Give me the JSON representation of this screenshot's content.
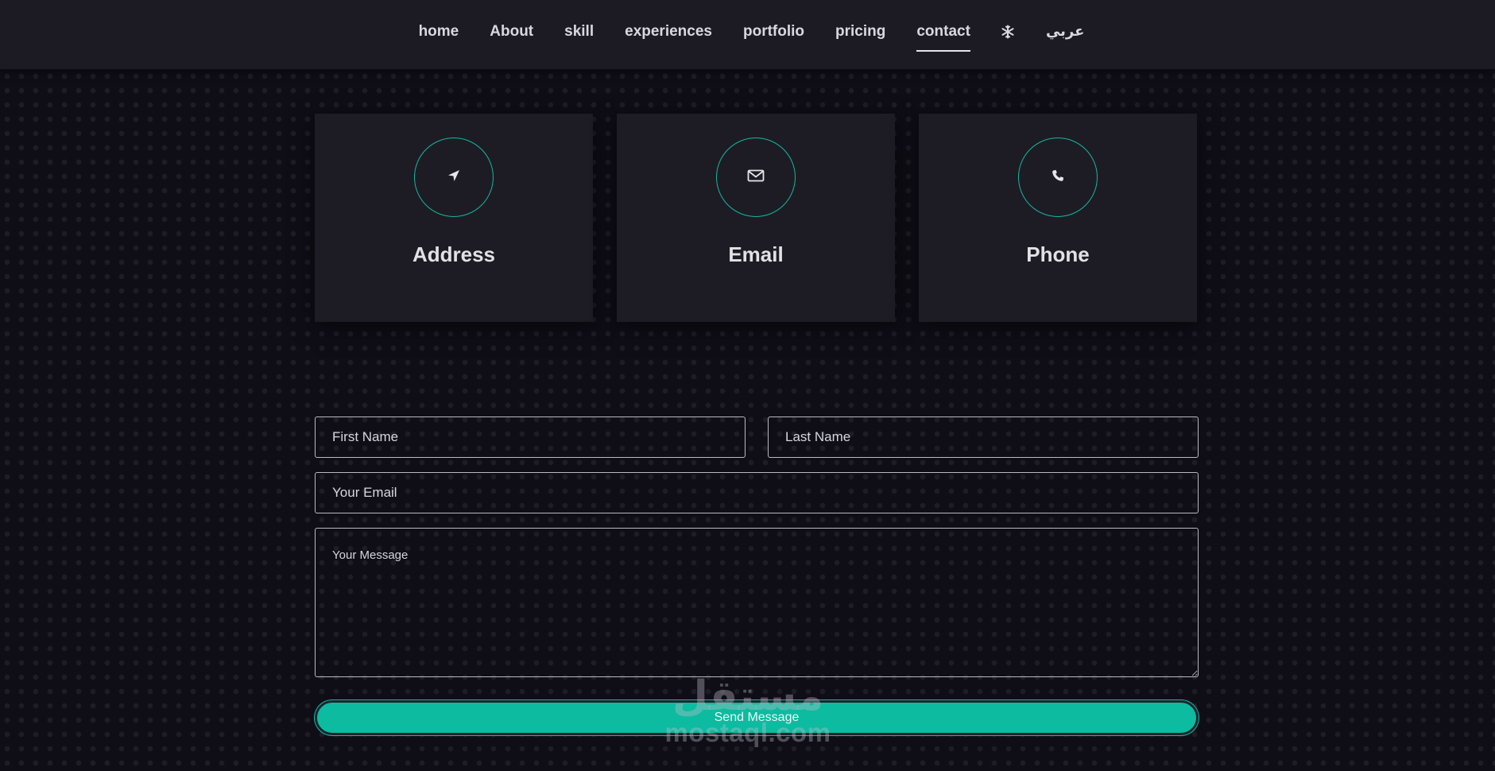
{
  "nav": {
    "items": [
      {
        "label": "home"
      },
      {
        "label": "About"
      },
      {
        "label": "skill"
      },
      {
        "label": "experiences"
      },
      {
        "label": "portfolio"
      },
      {
        "label": "pricing"
      },
      {
        "label": "contact",
        "active": true
      }
    ],
    "theme_icon": "snowflake-icon",
    "language_label": "عربي"
  },
  "contact_cards": [
    {
      "title": "Address",
      "icon": "location-arrow-icon"
    },
    {
      "title": "Email",
      "icon": "envelope-icon"
    },
    {
      "title": "Phone",
      "icon": "phone-icon"
    }
  ],
  "form": {
    "first_name_placeholder": "First Name",
    "last_name_placeholder": "Last Name",
    "email_placeholder": "Your Email",
    "message_placeholder": "Your Message",
    "send_label": "Send Message"
  },
  "watermark": {
    "arabic": "مستقل",
    "latin": "mostaql.com"
  },
  "colors": {
    "accent": "#0dbba0",
    "background": "#0f0e17",
    "navbar": "#1c1b23",
    "card": "#1d1c24"
  }
}
